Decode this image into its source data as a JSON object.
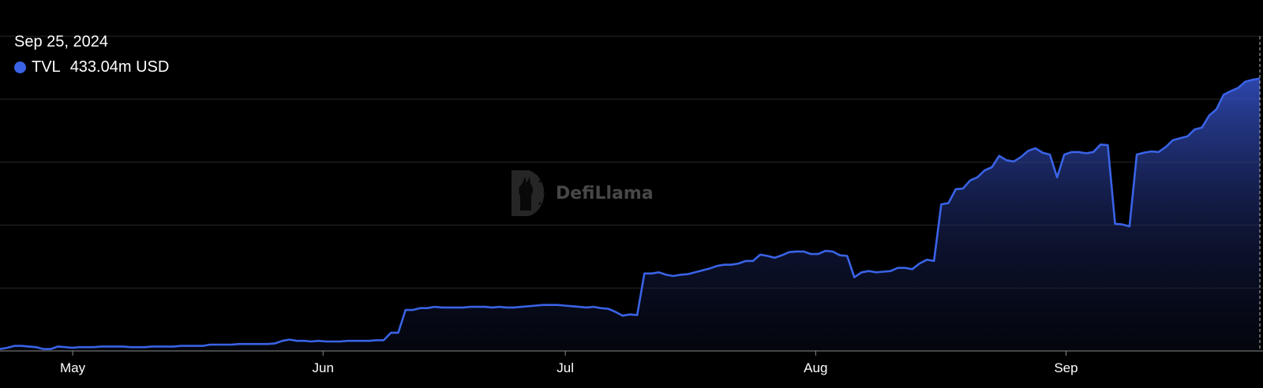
{
  "tooltip": {
    "date": "Sep 25, 2024",
    "metric": "TVL",
    "value": "433.04m USD"
  },
  "watermark": {
    "text": "DefiLlama"
  },
  "colors": {
    "line": "#3a63e6",
    "background": "#000000",
    "grid": "#2a2a2a",
    "axis": "#8a8a8a"
  },
  "chart_data": {
    "type": "area",
    "x_start": "Apr 22, 2024",
    "x_end": "Sep 25, 2024",
    "x_ticks": [
      "May",
      "Jun",
      "Jul",
      "Aug",
      "Sep"
    ],
    "ylim": [
      0,
      500
    ],
    "grid": true,
    "series": [
      {
        "name": "TVL",
        "values": [
          3,
          5,
          8,
          8,
          7,
          6,
          3,
          3,
          7,
          6,
          5,
          6,
          6,
          6,
          7,
          7,
          7,
          7,
          6,
          6,
          6,
          7,
          7,
          7,
          7,
          8,
          8,
          8,
          8,
          10,
          10,
          10,
          10,
          11,
          11,
          11,
          11,
          11,
          12,
          16,
          18,
          16,
          16,
          15,
          16,
          15,
          15,
          15,
          16,
          16,
          16,
          16,
          17,
          17,
          29,
          29,
          65,
          65,
          68,
          68,
          70,
          69,
          69,
          69,
          69,
          70,
          70,
          70,
          69,
          70,
          69,
          69,
          70,
          71,
          72,
          73,
          73,
          73,
          72,
          71,
          70,
          69,
          70,
          68,
          67,
          62,
          56,
          58,
          57,
          123,
          123,
          125,
          121,
          119,
          121,
          122,
          125,
          128,
          131,
          135,
          137,
          137,
          139,
          143,
          143,
          153,
          151,
          148,
          152,
          157,
          158,
          158,
          154,
          154,
          159,
          158,
          152,
          151,
          117,
          125,
          127,
          125,
          126,
          127,
          132,
          132,
          130,
          139,
          145,
          143,
          233,
          235,
          257,
          258,
          271,
          276,
          287,
          292,
          310,
          303,
          301,
          308,
          318,
          322,
          315,
          312,
          276,
          312,
          316,
          316,
          314,
          316,
          328,
          327,
          202,
          201,
          198,
          312,
          315,
          317,
          316,
          324,
          335,
          338,
          341,
          352,
          355,
          374,
          384,
          407,
          413,
          418,
          428,
          431,
          433
        ]
      }
    ]
  }
}
